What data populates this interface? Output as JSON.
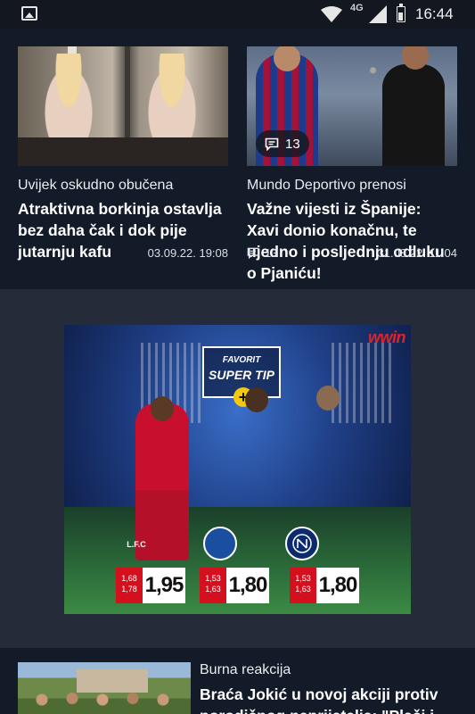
{
  "status_bar": {
    "network": "4G",
    "time": "16:44",
    "icons": [
      "image-notification-icon",
      "wifi-icon",
      "signal-icon",
      "battery-icon"
    ]
  },
  "articles": [
    {
      "kicker": "Uvijek oskudno obučena",
      "title": "Atraktivna borkinja ostavlja bez daha čak i dok pije jutarnju kafu",
      "date": "03.09.22. 19:08"
    },
    {
      "kicker": "Mundo Deportivo prenosi",
      "title": "Važne vijesti iz Španije: Xavi donio konačnu, te ujedno i posljednju odluku o Pjaniću!",
      "date": "31.08.22. 11:04",
      "comments": "13"
    }
  ],
  "ad": {
    "brand": "wwin",
    "favorit": "FAVORIT",
    "super_tip": "SUPER TIP",
    "plus": "+",
    "lfc_label": "L.F.C",
    "odds": [
      {
        "old": "1,68",
        "prev": "1,78",
        "value": "1,95"
      },
      {
        "old": "1,53",
        "prev": "1,63",
        "value": "1,80"
      },
      {
        "old": "1,53",
        "prev": "1,63",
        "value": "1,80"
      }
    ],
    "colors": {
      "accent": "#e22227",
      "odds_red": "#d5101e"
    }
  },
  "bottom_article": {
    "kicker": "Burna reakcija",
    "title": "Braća Jokić u novoj akciji protiv porodičnog neprijatelja: \"Plači i"
  },
  "colors": {
    "page_bg": "#252b38",
    "card_bg": "#131b28",
    "status_bg": "#131820"
  }
}
